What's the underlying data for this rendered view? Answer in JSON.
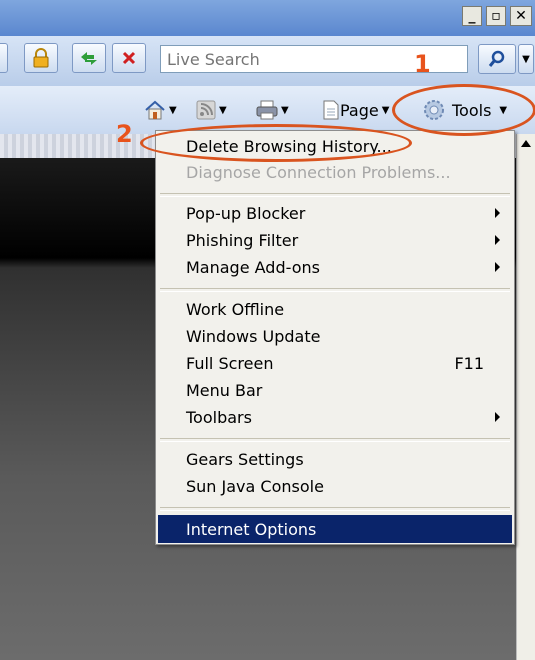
{
  "window": {
    "minimize_label": "_",
    "restore_label": "▫",
    "close_label": "✕"
  },
  "navbar": {
    "search_placeholder": "Live Search"
  },
  "command_bar": {
    "page_label": "Page",
    "tools_label": "Tools"
  },
  "menu": {
    "items": [
      {
        "label": "Delete Browsing History...",
        "state": "normal"
      },
      {
        "label": "Diagnose Connection Problems...",
        "state": "disabled"
      },
      {
        "label": "Pop-up Blocker",
        "submenu": true
      },
      {
        "label": "Phishing Filter",
        "submenu": true
      },
      {
        "label": "Manage Add-ons",
        "submenu": true
      },
      {
        "label": "Work Offline"
      },
      {
        "label": "Windows Update"
      },
      {
        "label": "Full Screen",
        "shortcut": "F11"
      },
      {
        "label": "Menu Bar"
      },
      {
        "label": "Toolbars",
        "submenu": true
      },
      {
        "label": "Gears Settings"
      },
      {
        "label": "Sun Java Console"
      },
      {
        "label": "Internet Options",
        "state": "selected"
      }
    ]
  },
  "annotations": {
    "one": "1",
    "two": "2",
    "color": "#d9541f"
  },
  "icons": {
    "lock": "lock-icon",
    "refresh": "refresh-icon",
    "stop": "stop-icon",
    "search": "search-icon",
    "home": "home-icon",
    "feeds": "feeds-icon",
    "print": "print-icon",
    "page": "page-icon",
    "gear": "gear-icon"
  },
  "colors": {
    "menu_selected": "#0a246a",
    "menu_bg": "#f2f1ec"
  }
}
